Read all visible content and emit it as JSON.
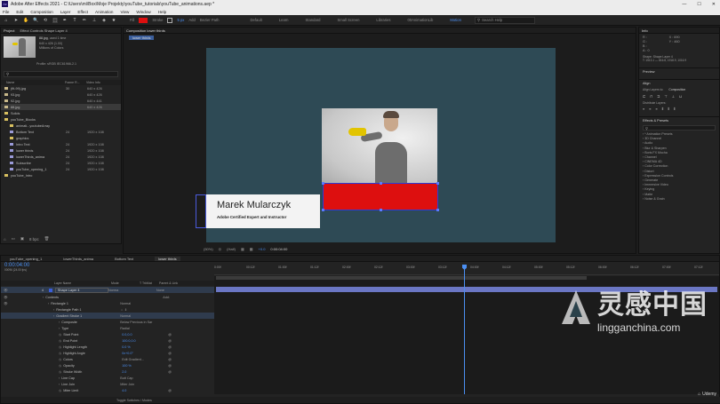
{
  "title": "Adobe After Effects 2021 - C:\\Users\\mi\\Box\\Moje Projekty\\youTube_tutorials\\youTube_animations.aep *",
  "window_controls": [
    "—",
    "☐",
    "✕"
  ],
  "menu": [
    "File",
    "Edit",
    "Composition",
    "Layer",
    "Effect",
    "Animation",
    "View",
    "Window",
    "Help"
  ],
  "toolbar": {
    "tools": [
      "⌂",
      "➤",
      "✋",
      "🔍",
      "⟲",
      "⬚",
      "✒",
      "T",
      "✏",
      "⊥",
      "◈",
      "★"
    ],
    "fill_label": "Fill",
    "stroke_label": "Stroke",
    "stroke_px": "5 px",
    "add_label": "Add",
    "bezier_label": "Bezier Path",
    "workspaces": [
      "Default",
      "Learn",
      "Standard",
      "Small Screen",
      "Libraries",
      "00AnimationLib"
    ],
    "active_workspace": "Motion",
    "search_placeholder": "Search Help"
  },
  "project": {
    "tab": "Project",
    "effect_tab": "Effect Controls Shape Layer 4",
    "item_name": "88.jpg",
    "item_used": ", used 1 time",
    "item_dims": "640 x 426 (1.00)",
    "item_colors": "Millions of Colors",
    "profile": "Profile: sRGB IEC61966-2.1",
    "search_placeholder": "",
    "headers": [
      "Name",
      "Frame R...",
      "Video Info"
    ],
    "items": [
      {
        "name": "(fit-99).jpg",
        "rate": "30",
        "info": "640 x 426",
        "color": "#c8b88a",
        "indent": 0
      },
      {
        "name": "93.jpg",
        "rate": "",
        "info": "640 x 426",
        "color": "#c8b88a",
        "indent": 0
      },
      {
        "name": "92.jpg",
        "rate": "",
        "info": "640 x 441",
        "color": "#c8b88a",
        "indent": 0
      },
      {
        "name": "88.jpg",
        "rate": "",
        "info": "640 x 426",
        "color": "#c8b88a",
        "indent": 0,
        "selected": true
      },
      {
        "name": "Solids",
        "rate": "",
        "info": "",
        "color": "#d8c060",
        "indent": 0
      },
      {
        "name": "youTube_Blocks",
        "rate": "",
        "info": "",
        "color": "#d8c060",
        "indent": 0
      },
      {
        "name": "animati...youtubeArray",
        "rate": "",
        "info": "",
        "color": "#d8c060",
        "indent": 1
      },
      {
        "name": "Bottom Text",
        "rate": "24",
        "info": "1920 x 108",
        "color": "#9a9ad8",
        "indent": 1
      },
      {
        "name": "graphics",
        "rate": "",
        "info": "",
        "color": "#d8c060",
        "indent": 1
      },
      {
        "name": "Intro Text",
        "rate": "24",
        "info": "1920 x 108",
        "color": "#9a9ad8",
        "indent": 1
      },
      {
        "name": "lower thirds",
        "rate": "24",
        "info": "1920 x 108",
        "color": "#9a9ad8",
        "indent": 1
      },
      {
        "name": "lowerThirds_anima",
        "rate": "24",
        "info": "1920 x 108",
        "color": "#9a9ad8",
        "indent": 1
      },
      {
        "name": "Subscribe",
        "rate": "24",
        "info": "1920 x 108",
        "color": "#9a9ad8",
        "indent": 1
      },
      {
        "name": "youTube_opening_1",
        "rate": "24",
        "info": "1920 x 108",
        "color": "#9a9ad8",
        "indent": 1
      },
      {
        "name": "youTube_Intro",
        "rate": "",
        "info": "",
        "color": "#d8c060",
        "indent": 0
      }
    ],
    "bpc": "8 bpc"
  },
  "composition": {
    "tab": "Composition lower thirds",
    "sub_tab": "lower thirds",
    "name_text": "Marek Mularczyk",
    "subtitle_text": "Adobe Certified Expert and Instructor",
    "zoom": "(50%)",
    "quality": "(Half)",
    "timecode": "0:00:04:00",
    "frame_offset": "+0.0",
    "bg": "#2e4a55",
    "red": "#dd0f0f"
  },
  "info_panel": {
    "tab": "Info",
    "r": "R :",
    "g": "G :",
    "b": "B :",
    "a": "A : 0",
    "x": "X : 690",
    "y": "Y : 460",
    "shape_label": "Shape: Shape Layer 4",
    "shape_pos": "T: 1513.1 — 816.8, 1918.9, 1016.9",
    "preview": "Preview",
    "align": "Align",
    "align_to_label": "Align Layers to:",
    "align_to": "Composition",
    "distribute": "Distribute Layers:"
  },
  "effects": {
    "tab": "Effects & Presets",
    "search_placeholder": "",
    "items": [
      "* Animation Presets",
      "3D Channel",
      "Audio",
      "Blur & Sharpen",
      "Boris FX Mocha",
      "Channel",
      "CINEMA 4D",
      "Color Correction",
      "Distort",
      "Expression Controls",
      "Generate",
      "Immersive Video",
      "Keying",
      "Matte",
      "Noise & Grain"
    ]
  },
  "timeline": {
    "tabs": [
      "youTube_opening_1",
      "lowerThirds_anima",
      "Bottom Text",
      "lower thirds"
    ],
    "time": "0:00:04:00",
    "time_sub": "00096 (24.00 fps)",
    "headers": [
      "Layer Name",
      "Mode",
      "T TrkMat",
      "Parent & Link"
    ],
    "ruler": [
      "0:00f",
      "00:12f",
      "01:00f",
      "01:12f",
      "02:00f",
      "02:12f",
      "03:00f",
      "03:12f",
      "04:00f",
      "04:12f",
      "05:00f",
      "05:12f",
      "06:00f",
      "06:12f",
      "07:00f",
      "07:12f"
    ],
    "layer": {
      "num": "4",
      "name": "Shape Layer 4",
      "mode": "Norma",
      "parent": "None"
    },
    "props": [
      {
        "name": "Contents",
        "value": "",
        "indent": 1,
        "add": "Add:"
      },
      {
        "name": "Rectangle 1",
        "value": "Normal",
        "indent": 2
      },
      {
        "name": "Rectangle Path 1",
        "value": "⇔ ⇕",
        "indent": 3
      },
      {
        "name": "Gradient Stroke 1",
        "value": "Normal",
        "indent": 3,
        "selected": true
      },
      {
        "name": "Composite",
        "value": "Below Previous in Sar",
        "indent": 4
      },
      {
        "name": "Type",
        "value": "Radial",
        "indent": 4
      },
      {
        "name": "Start Point",
        "value": "0.0,0.0",
        "indent": 4,
        "stopwatch": true
      },
      {
        "name": "End Point",
        "value": "100.0,0.0",
        "indent": 4,
        "stopwatch": true
      },
      {
        "name": "Highlight Length",
        "value": "0.0 %",
        "indent": 4,
        "stopwatch": true
      },
      {
        "name": "Highlight Angle",
        "value": "0x+0.0°",
        "indent": 4,
        "stopwatch": true
      },
      {
        "name": "Colors",
        "value": "Edit Gradient...",
        "indent": 4,
        "stopwatch": true
      },
      {
        "name": "Opacity",
        "value": "100 %",
        "indent": 4,
        "stopwatch": true
      },
      {
        "name": "Stroke Width",
        "value": "2.0",
        "indent": 4,
        "stopwatch": true
      },
      {
        "name": "Line Cap",
        "value": "Butt Cap",
        "indent": 4
      },
      {
        "name": "Line Join",
        "value": "Miter Join",
        "indent": 4
      },
      {
        "name": "Miter Limit",
        "value": "4.0",
        "indent": 4,
        "stopwatch": true
      }
    ],
    "footer": "Toggle Switches / Modes"
  },
  "watermark": {
    "cn": "灵感中国",
    "url": "lingganchina.com"
  },
  "udemy": "Udemy"
}
